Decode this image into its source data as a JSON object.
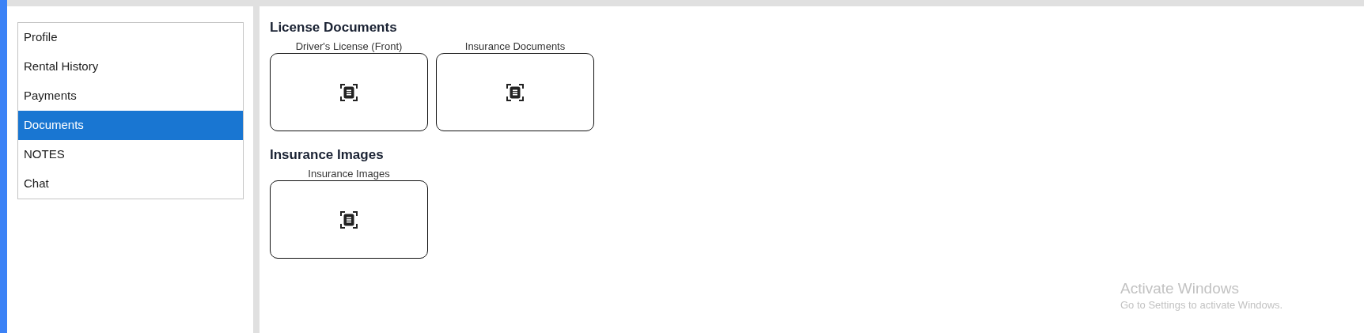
{
  "sidebar": {
    "items": [
      {
        "label": "Profile",
        "selected": false
      },
      {
        "label": "Rental History",
        "selected": false
      },
      {
        "label": "Payments",
        "selected": false
      },
      {
        "label": "Documents",
        "selected": true
      },
      {
        "label": "NOTES",
        "selected": false
      },
      {
        "label": "Chat",
        "selected": false
      }
    ]
  },
  "sections": [
    {
      "title": "License Documents",
      "uploads": [
        {
          "label": "Driver's License (Front)"
        },
        {
          "label": "Insurance Documents"
        }
      ]
    },
    {
      "title": "Insurance Images",
      "uploads": [
        {
          "label": "Insurance Images"
        }
      ]
    }
  ],
  "os_overlay": {
    "title": "Activate Windows",
    "message": "Go to Settings to activate Windows."
  }
}
